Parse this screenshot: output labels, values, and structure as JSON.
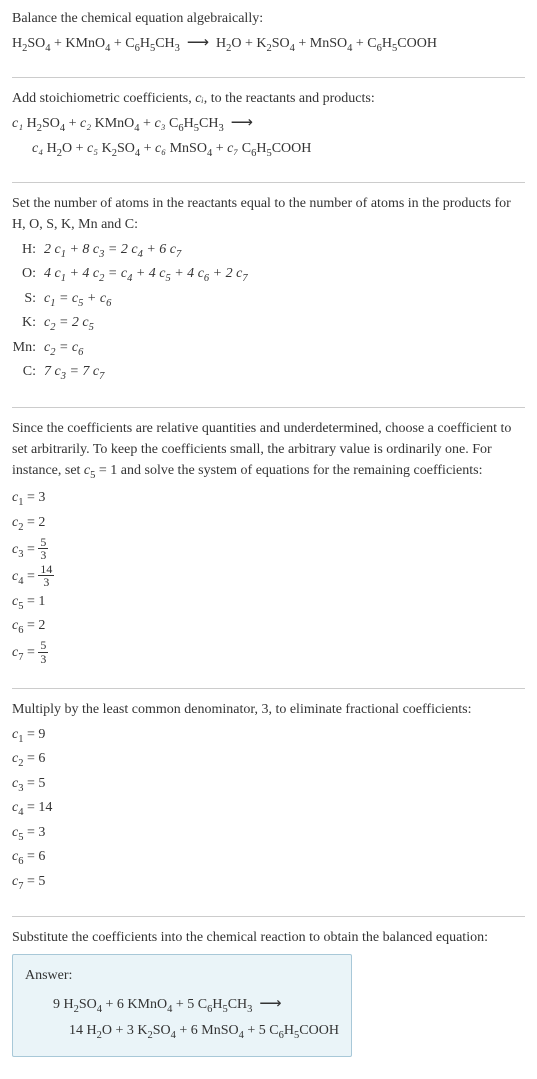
{
  "intro": {
    "line1": "Balance the chemical equation algebraically:",
    "eq_lhs": "H₂SO₄ + KMnO₄ + C₆H₅CH₃",
    "arrow": "⟶",
    "eq_rhs": "H₂O + K₂SO₄ + MnSO₄ + C₆H₅COOH"
  },
  "stoich": {
    "text": "Add stoichiometric coefficients, ",
    "ci": "cᵢ",
    "text2": ", to the reactants and products:",
    "eq1_c1": "c₁",
    "eq1_t1": " H₂SO₄ + ",
    "eq1_c2": "c₂",
    "eq1_t2": " KMnO₄ + ",
    "eq1_c3": "c₃",
    "eq1_t3": " C₆H₅CH₃ ",
    "arrow": "⟶",
    "eq2_c4": "c₄",
    "eq2_t4": " H₂O + ",
    "eq2_c5": "c₅",
    "eq2_t5": " K₂SO₄ + ",
    "eq2_c6": "c₆",
    "eq2_t6": " MnSO₄ + ",
    "eq2_c7": "c₇",
    "eq2_t7": " C₆H₅COOH"
  },
  "atoms": {
    "text": "Set the number of atoms in the reactants equal to the number of atoms in the products for H, O, S, K, Mn and C:",
    "rows": [
      {
        "label": "H:",
        "eq": "2 c₁ + 8 c₃ = 2 c₄ + 6 c₇"
      },
      {
        "label": "O:",
        "eq": "4 c₁ + 4 c₂ = c₄ + 4 c₅ + 4 c₆ + 2 c₇"
      },
      {
        "label": "S:",
        "eq": "c₁ = c₅ + c₆"
      },
      {
        "label": "K:",
        "eq": "c₂ = 2 c₅"
      },
      {
        "label": "Mn:",
        "eq": "c₂ = c₆"
      },
      {
        "label": "C:",
        "eq": "7 c₃ = 7 c₇"
      }
    ]
  },
  "underdetermined": {
    "text": "Since the coefficients are relative quantities and underdetermined, choose a coefficient to set arbitrarily. To keep the coefficients small, the arbitrary value is ordinarily one. For instance, set c₅ = 1 and solve the system of equations for the remaining coefficients:",
    "coefs": [
      {
        "lhs": "c₁",
        "eq": "= 3",
        "frac": null
      },
      {
        "lhs": "c₂",
        "eq": "= 2",
        "frac": null
      },
      {
        "lhs": "c₃",
        "eq": "= ",
        "frac": {
          "num": "5",
          "den": "3"
        }
      },
      {
        "lhs": "c₄",
        "eq": "= ",
        "frac": {
          "num": "14",
          "den": "3"
        }
      },
      {
        "lhs": "c₅",
        "eq": "= 1",
        "frac": null
      },
      {
        "lhs": "c₆",
        "eq": "= 2",
        "frac": null
      },
      {
        "lhs": "c₇",
        "eq": "= ",
        "frac": {
          "num": "5",
          "den": "3"
        }
      }
    ]
  },
  "multiply": {
    "text": "Multiply by the least common denominator, 3, to eliminate fractional coefficients:",
    "coefs": [
      {
        "lhs": "c₁",
        "val": "= 9"
      },
      {
        "lhs": "c₂",
        "val": "= 6"
      },
      {
        "lhs": "c₃",
        "val": "= 5"
      },
      {
        "lhs": "c₄",
        "val": "= 14"
      },
      {
        "lhs": "c₅",
        "val": "= 3"
      },
      {
        "lhs": "c₆",
        "val": "= 6"
      },
      {
        "lhs": "c₇",
        "val": "= 5"
      }
    ]
  },
  "substitute": {
    "text": "Substitute the coefficients into the chemical reaction to obtain the balanced equation:"
  },
  "answer": {
    "label": "Answer:",
    "eq1": "9 H₂SO₄ + 6 KMnO₄ + 5 C₆H₅CH₃ ",
    "arrow": "⟶",
    "eq2": "14 H₂O + 3 K₂SO₄ + 6 MnSO₄ + 5 C₆H₅COOH"
  }
}
